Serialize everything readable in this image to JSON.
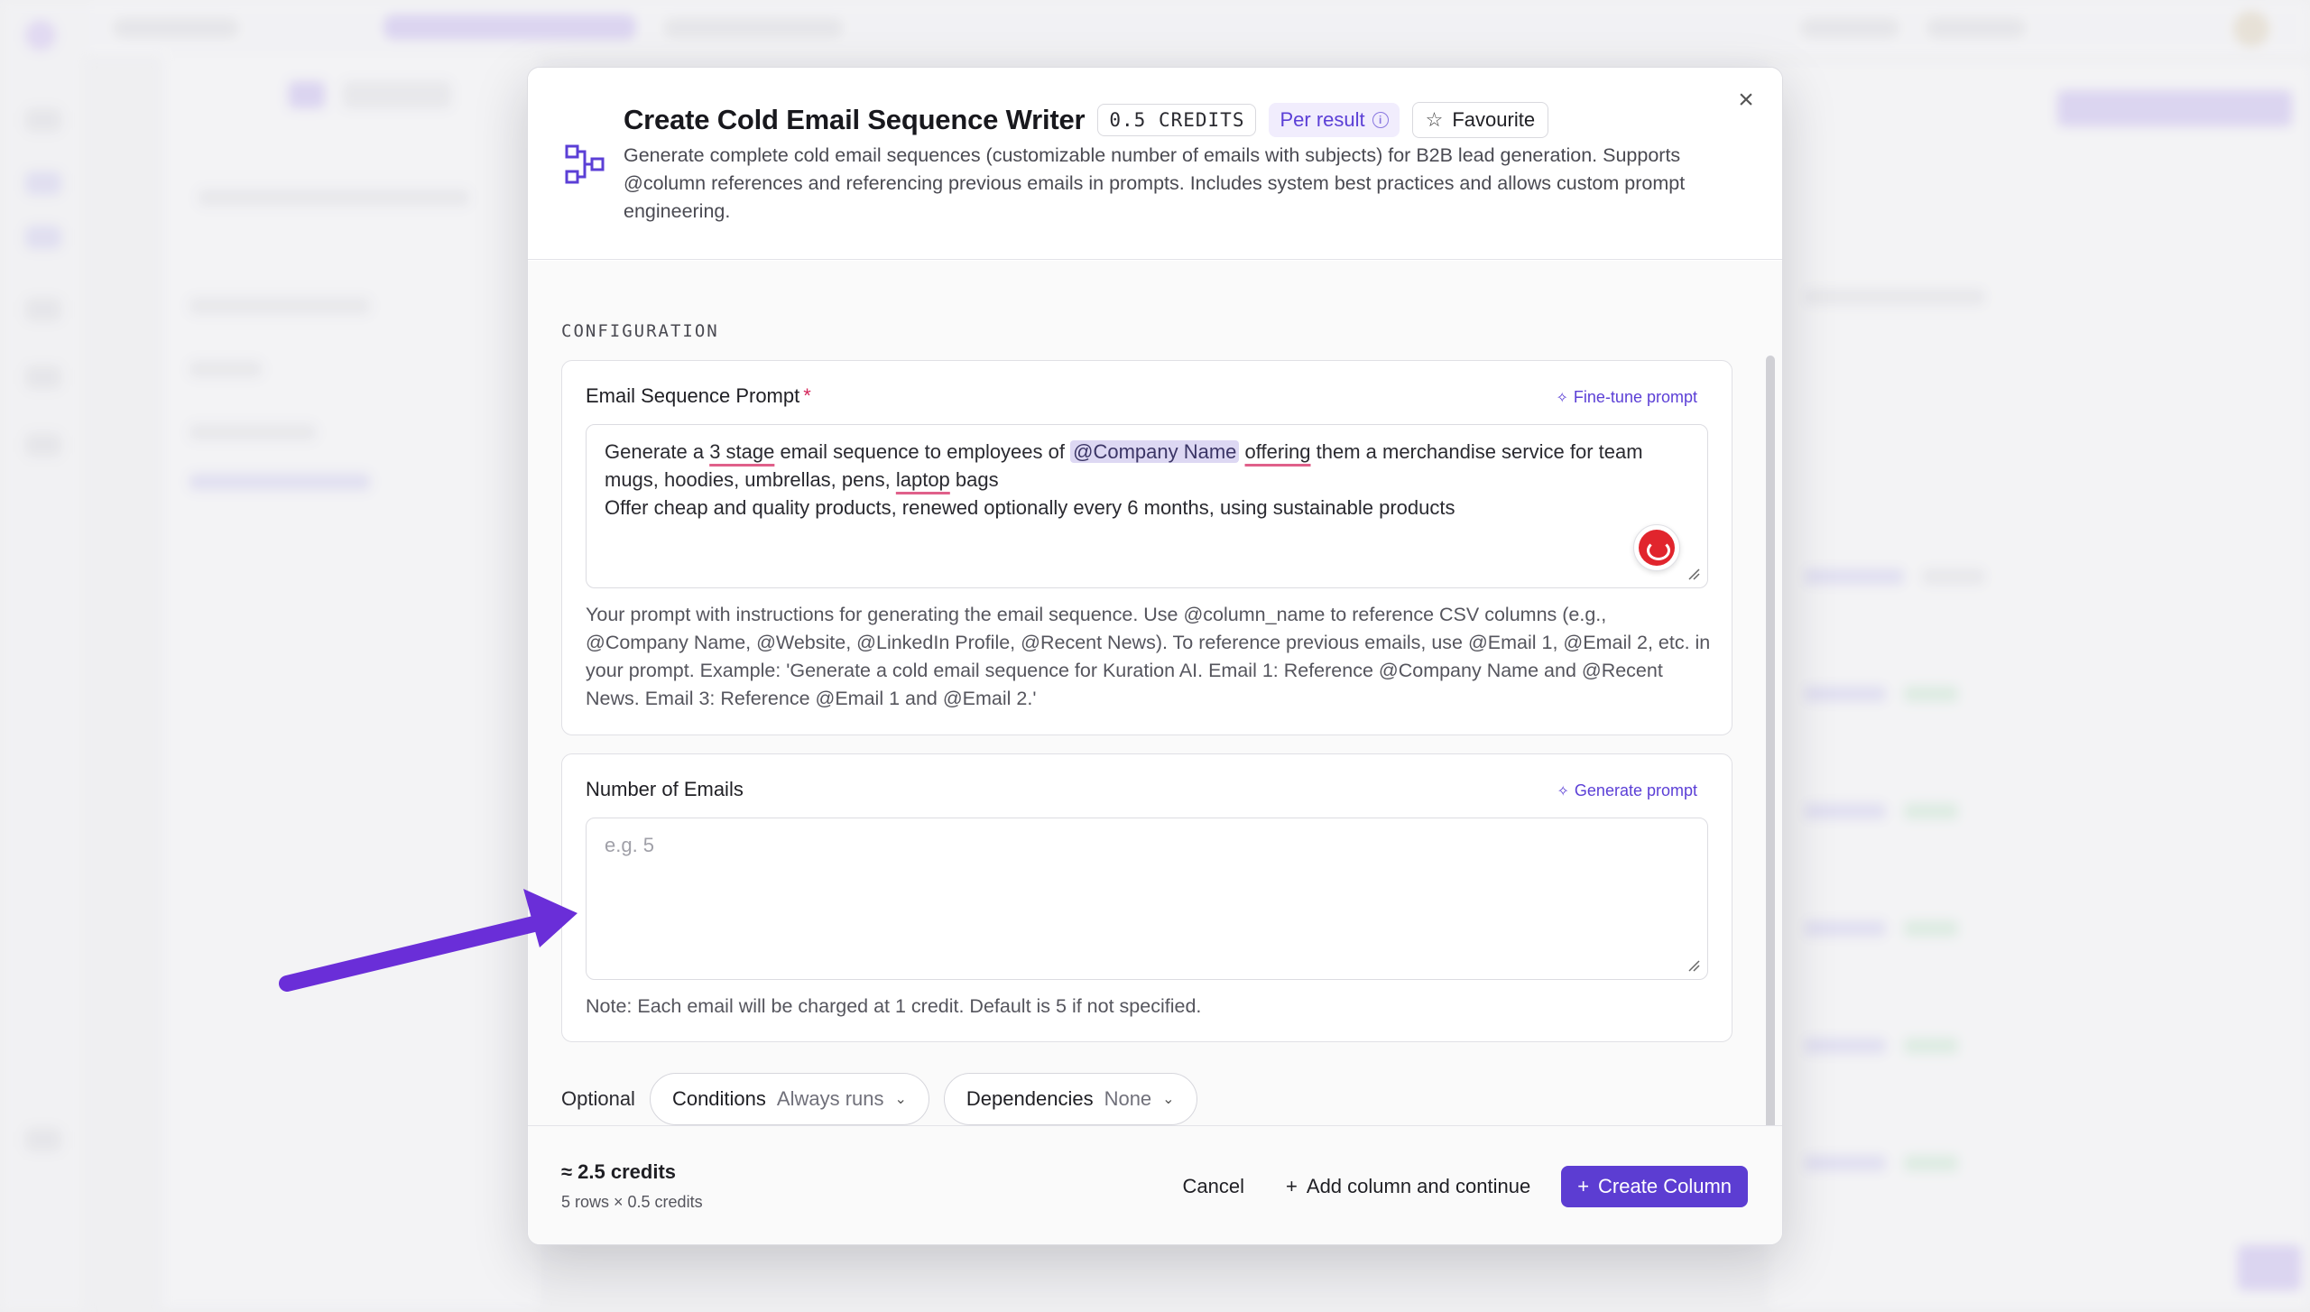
{
  "modal": {
    "title": "Create Cold Email Sequence Writer",
    "credits_chip": "0.5 CREDITS",
    "per_result": "Per result",
    "favourite": "Favourite",
    "description": "Generate complete cold email sequences (customizable number of emails with subjects) for B2B lead generation. Supports @column references and referencing previous emails in prompts. Includes system best practices and allows custom prompt engineering."
  },
  "configuration": {
    "section_label": "CONFIGURATION",
    "email_prompt": {
      "label": "Email Sequence Prompt",
      "required_mark": "*",
      "action": "Fine-tune prompt",
      "value": {
        "p1": "Generate a ",
        "p2": "3 stage",
        "p3": " email sequence to employees of ",
        "mention": "@Company Name",
        "p4": " ",
        "p5": "offering",
        "p6": " them a merchandise service for team mugs, hoodies, umbrellas, pens, ",
        "p7": "laptop",
        "p8": " bags",
        "line2": "Offer cheap and quality products, renewed optionally every 6 months, using sustainable products"
      },
      "helper": "Your prompt with instructions for generating the email sequence. Use @column_name to reference CSV columns (e.g., @Company Name, @Website, @LinkedIn Profile, @Recent News). To reference previous emails, use @Email 1, @Email 2, etc. in your prompt. Example: 'Generate a cold email sequence for Kuration AI. Email 1: Reference @Company Name and @Recent News. Email 3: Reference @Email 1 and @Email 2.'"
    },
    "num_emails": {
      "label": "Number of Emails",
      "action": "Generate prompt",
      "placeholder": "e.g. 5",
      "helper": "Note: Each email will be charged at 1 credit. Default is 5 if not specified."
    },
    "optional": {
      "label": "Optional",
      "conditions_label": "Conditions",
      "conditions_value": "Always runs",
      "dependencies_label": "Dependencies",
      "dependencies_value": "None"
    }
  },
  "footer": {
    "estimate": "≈ 2.5 credits",
    "estimate_detail": "5 rows × 0.5 credits",
    "cancel": "Cancel",
    "add_continue": "Add column and continue",
    "create": "Create Column"
  },
  "colors": {
    "accent": "#5c3dd2",
    "annotation_arrow": "#6a2ed8",
    "required": "#d4265a"
  }
}
